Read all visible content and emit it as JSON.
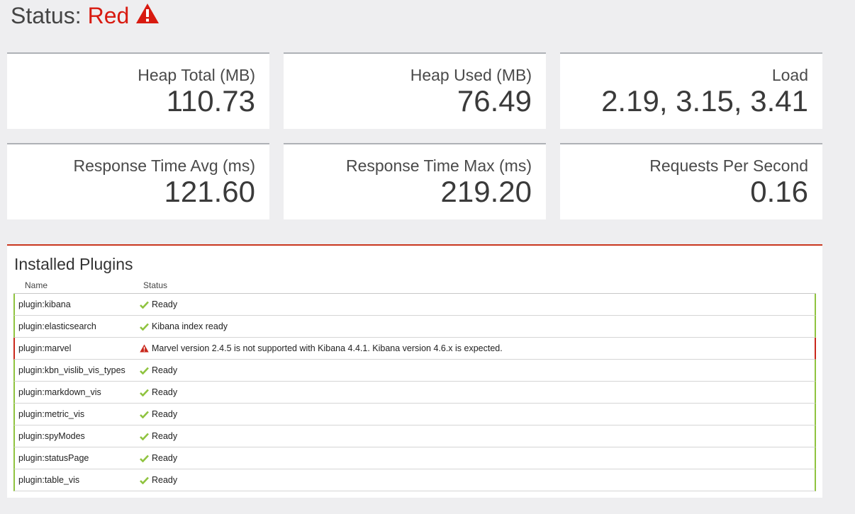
{
  "overall": {
    "prefix": "Status:",
    "state": "Red",
    "state_color": "#d81a10",
    "icon": "warning-triangle-icon"
  },
  "metrics": [
    {
      "label": "Heap Total (MB)",
      "value": "110.73"
    },
    {
      "label": "Heap Used (MB)",
      "value": "76.49"
    },
    {
      "label": "Load",
      "value": "2.19, 3.15, 3.41"
    },
    {
      "label": "Response Time Avg (ms)",
      "value": "121.60"
    },
    {
      "label": "Response Time Max (ms)",
      "value": "219.20"
    },
    {
      "label": "Requests Per Second",
      "value": "0.16"
    }
  ],
  "plugins": {
    "title": "Installed Plugins",
    "columns": {
      "name": "Name",
      "status": "Status"
    },
    "rows": [
      {
        "name": "plugin:kibana",
        "state": "green",
        "icon": "checkmark-icon",
        "message": "Ready"
      },
      {
        "name": "plugin:elasticsearch",
        "state": "green",
        "icon": "checkmark-icon",
        "message": "Kibana index ready"
      },
      {
        "name": "plugin:marvel",
        "state": "red",
        "icon": "warning-triangle-icon",
        "message": "Marvel version 2.4.5 is not supported with Kibana 4.4.1. Kibana version 4.6.x is expected."
      },
      {
        "name": "plugin:kbn_vislib_vis_types",
        "state": "green",
        "icon": "checkmark-icon",
        "message": "Ready"
      },
      {
        "name": "plugin:markdown_vis",
        "state": "green",
        "icon": "checkmark-icon",
        "message": "Ready"
      },
      {
        "name": "plugin:metric_vis",
        "state": "green",
        "icon": "checkmark-icon",
        "message": "Ready"
      },
      {
        "name": "plugin:spyModes",
        "state": "green",
        "icon": "checkmark-icon",
        "message": "Ready"
      },
      {
        "name": "plugin:statusPage",
        "state": "green",
        "icon": "checkmark-icon",
        "message": "Ready"
      },
      {
        "name": "plugin:table_vis",
        "state": "green",
        "icon": "checkmark-icon",
        "message": "Ready"
      }
    ]
  },
  "colors": {
    "green": "#8fc33f",
    "red": "#c9271b",
    "panel_border": "#aeb1b6",
    "background": "#eeeef0"
  }
}
